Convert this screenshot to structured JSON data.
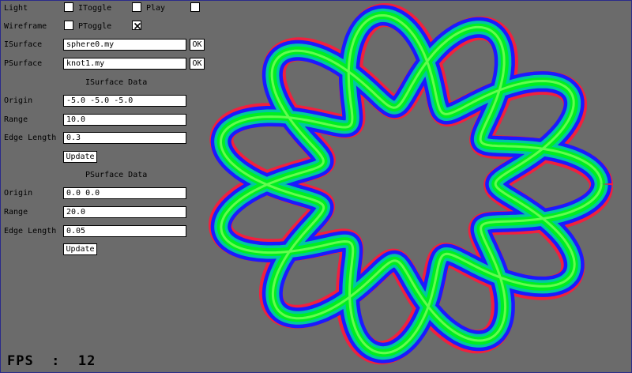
{
  "controls": {
    "light_label": "Light",
    "light_checked": false,
    "itoggle_label": "IToggle",
    "itoggle_checked": false,
    "play_label": "Play",
    "play_checked": false,
    "extra_checked": false,
    "wireframe_label": "Wireframe",
    "wireframe_checked": false,
    "ptoggle_label": "PToggle",
    "ptoggle_checked": true,
    "isurface_label": "ISurface",
    "isurface_value": "sphere0.my",
    "isurface_ok": "OK",
    "psurface_label": "PSurface",
    "psurface_value": "knot1.my",
    "psurface_ok": "OK"
  },
  "isurface_data": {
    "title": "ISurface Data",
    "origin_label": "Origin",
    "origin_value": "-5.0 -5.0 -5.0",
    "range_label": "Range",
    "range_value": "10.0",
    "edge_label": "Edge Length",
    "edge_value": "0.3",
    "update_label": "Update"
  },
  "psurface_data": {
    "title": "PSurface Data",
    "origin_label": "Origin",
    "origin_value": "0.0 0.0",
    "range_label": "Range",
    "range_value": "20.0",
    "edge_label": "Edge Length",
    "edge_value": "0.05",
    "update_label": "Update"
  },
  "status": {
    "fps_text": "FPS  :  12"
  },
  "colors": {
    "background": "#6b6b6b",
    "knot_outer": "#1a1aff",
    "knot_mid": "#00ee22",
    "knot_edge": "#ff1a3a"
  },
  "icons": {
    "checked_mark": "x-mark-icon"
  }
}
